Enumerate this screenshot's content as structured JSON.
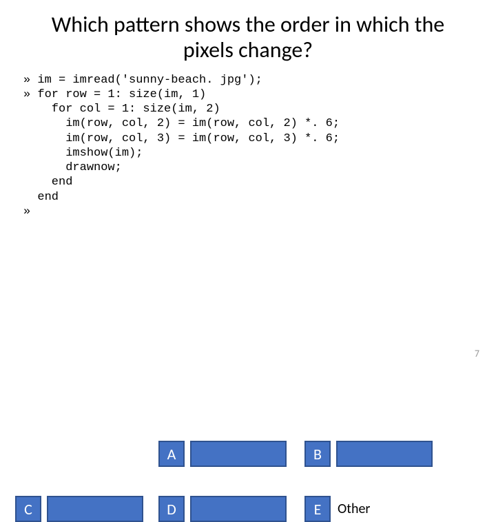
{
  "title": "Which pattern shows the order in which the pixels change?",
  "code_lines": [
    "» im = imread('sunny-beach. jpg');",
    "» for row = 1: size(im, 1)",
    "    for col = 1: size(im, 2)",
    "      im(row, col, 2) = im(row, col, 2) *. 6;",
    "      im(row, col, 3) = im(row, col, 3) *. 6;",
    "      imshow(im);",
    "      drawnow;",
    "    end",
    "  end",
    "»"
  ],
  "options": {
    "a": {
      "label": "A"
    },
    "b": {
      "label": "B"
    },
    "c": {
      "label": "C"
    },
    "d": {
      "label": "D"
    },
    "e": {
      "label": "E",
      "text": "Other"
    }
  },
  "page_number": "7"
}
